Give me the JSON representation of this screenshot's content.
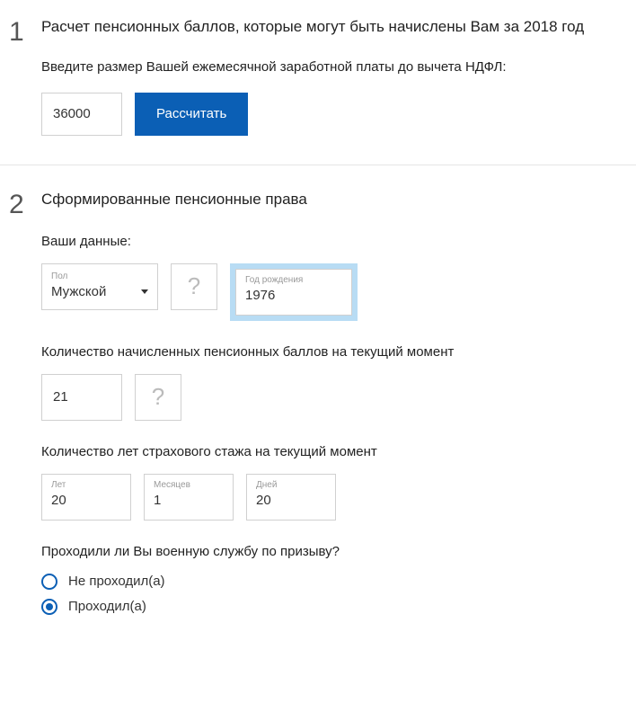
{
  "step1": {
    "number": "1",
    "title": "Расчет пенсионных баллов, которые могут быть начислены Вам за 2018 год",
    "prompt": "Введите размер Вашей ежемесячной заработной платы до вычета НДФЛ:",
    "salary_value": "36000",
    "calc_button": "Рассчитать"
  },
  "step2": {
    "number": "2",
    "title": "Сформированные пенсионные права",
    "your_data_label": "Ваши данные:",
    "gender": {
      "label": "Пол",
      "value": "Мужской"
    },
    "help_symbol": "?",
    "birth_year": {
      "label": "Год рождения",
      "value": "1976"
    },
    "points_label": "Количество начисленных пенсионных баллов на текущий момент",
    "points_value": "21",
    "stage_label": "Количество лет страхового стажа на текущий момент",
    "years": {
      "label": "Лет",
      "value": "20"
    },
    "months": {
      "label": "Месяцев",
      "value": "1"
    },
    "days": {
      "label": "Дней",
      "value": "20"
    },
    "military_question": "Проходили ли Вы военную службу по призыву?",
    "military_no": "Не проходил(а)",
    "military_yes": "Проходил(а)",
    "military_selected": "yes"
  }
}
